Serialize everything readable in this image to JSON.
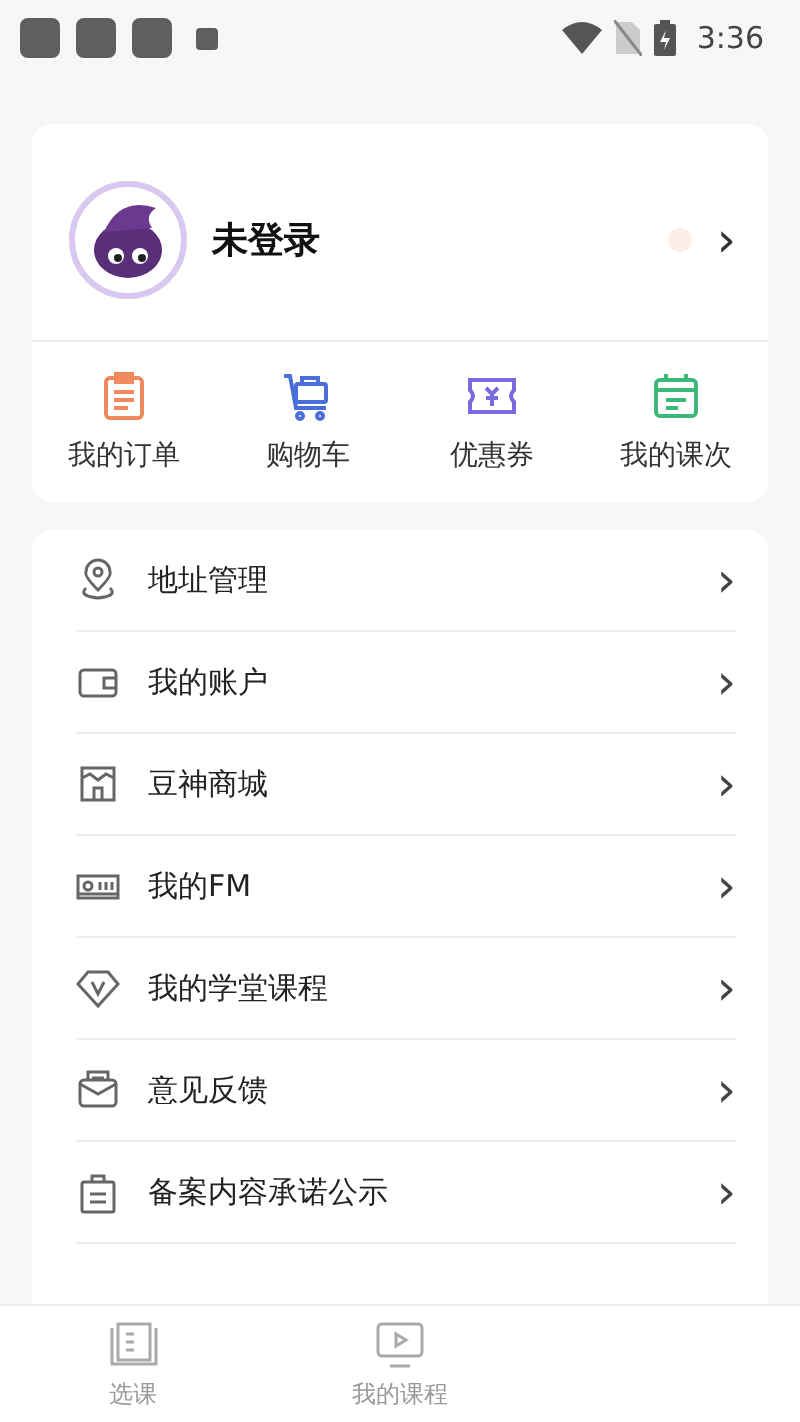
{
  "status_bar": {
    "time": "3:36"
  },
  "profile": {
    "name": "未登录",
    "chevron": "›"
  },
  "shortcuts": [
    {
      "label": "我的订单",
      "kind": "order"
    },
    {
      "label": "购物车",
      "kind": "cart"
    },
    {
      "label": "优惠券",
      "kind": "coupon"
    },
    {
      "label": "我的课次",
      "kind": "calendar"
    }
  ],
  "menu": [
    {
      "label": "地址管理",
      "kind": "location",
      "chevron": "›"
    },
    {
      "label": "我的账户",
      "kind": "wallet",
      "chevron": "›"
    },
    {
      "label": "豆神商城",
      "kind": "shop",
      "chevron": "›"
    },
    {
      "label": "我的FM",
      "kind": "radio",
      "chevron": "›"
    },
    {
      "label": "我的学堂课程",
      "kind": "vbadge",
      "chevron": "›"
    },
    {
      "label": "意见反馈",
      "kind": "mail",
      "chevron": "›"
    },
    {
      "label": "备案内容承诺公示",
      "kind": "clipboard",
      "chevron": "›"
    }
  ],
  "tabs": [
    {
      "label": "选课",
      "kind": "book",
      "selected": false
    },
    {
      "label": "我的课程",
      "kind": "video",
      "selected": false
    }
  ]
}
